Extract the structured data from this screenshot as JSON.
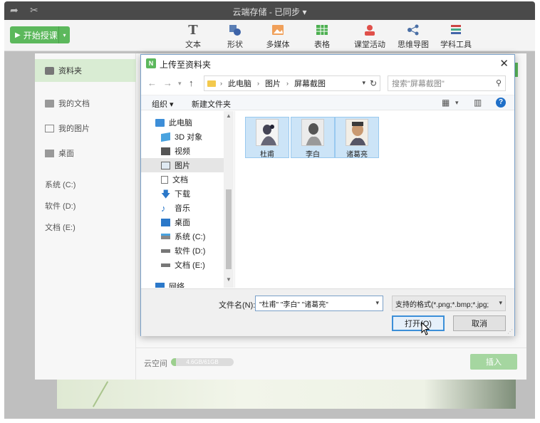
{
  "window": {
    "title": "云端存储 - 已同步 ▾"
  },
  "toolbar": {
    "start_label": "开始授课",
    "tools": [
      {
        "label": "文本",
        "icon": "text-icon"
      },
      {
        "label": "形状",
        "icon": "shape-icon"
      },
      {
        "label": "多媒体",
        "icon": "multimedia-icon"
      },
      {
        "label": "表格",
        "icon": "table-icon"
      },
      {
        "label": "课堂活动",
        "icon": "class-activity-icon"
      },
      {
        "label": "思维导图",
        "icon": "mindmap-icon"
      },
      {
        "label": "学科工具",
        "icon": "subject-tools-icon"
      }
    ]
  },
  "cloud": {
    "sidebar": [
      {
        "label": "资料夹",
        "active": true
      },
      {
        "label": "我的文档"
      },
      {
        "label": "我的图片"
      },
      {
        "label": "桌面"
      },
      {
        "label": "系统 (C:)"
      },
      {
        "label": "软件 (D:)"
      },
      {
        "label": "文档 (E:)"
      }
    ],
    "storage_label": "云空间",
    "storage_text": "4.6GB/61GB",
    "storage_fraction": 0.075,
    "insert_label": "插入"
  },
  "dialog": {
    "title": "上传至资料夹",
    "breadcrumb": [
      "此电脑",
      "图片",
      "屏幕截图"
    ],
    "search_placeholder": "搜索\"屏幕截图\"",
    "organize_label": "组织 ▾",
    "new_folder_label": "新建文件夹",
    "tree": [
      {
        "label": "此电脑",
        "icon": "computer-icon"
      },
      {
        "label": "3D 对象",
        "icon": "3d-objects-icon"
      },
      {
        "label": "视频",
        "icon": "video-icon"
      },
      {
        "label": "图片",
        "icon": "pictures-icon",
        "selected": true
      },
      {
        "label": "文档",
        "icon": "documents-icon"
      },
      {
        "label": "下载",
        "icon": "download-icon"
      },
      {
        "label": "音乐",
        "icon": "music-icon"
      },
      {
        "label": "桌面",
        "icon": "desktop-icon"
      },
      {
        "label": "系统 (C:)",
        "icon": "drive-c-icon"
      },
      {
        "label": "软件 (D:)",
        "icon": "drive-icon"
      },
      {
        "label": "文档 (E:)",
        "icon": "drive-icon"
      },
      {
        "label": "网络",
        "icon": "network-icon"
      }
    ],
    "files": [
      {
        "name": "杜甫"
      },
      {
        "name": "李白"
      },
      {
        "name": "诸葛亮"
      }
    ],
    "filename_label": "文件名(N):",
    "filename_value": "\"杜甫\" \"李白\" \"诸葛亮\"",
    "filter_value": "支持的格式(*.png;*.bmp;*.jpg;",
    "open_label": "打开(O)",
    "cancel_label": "取消"
  }
}
